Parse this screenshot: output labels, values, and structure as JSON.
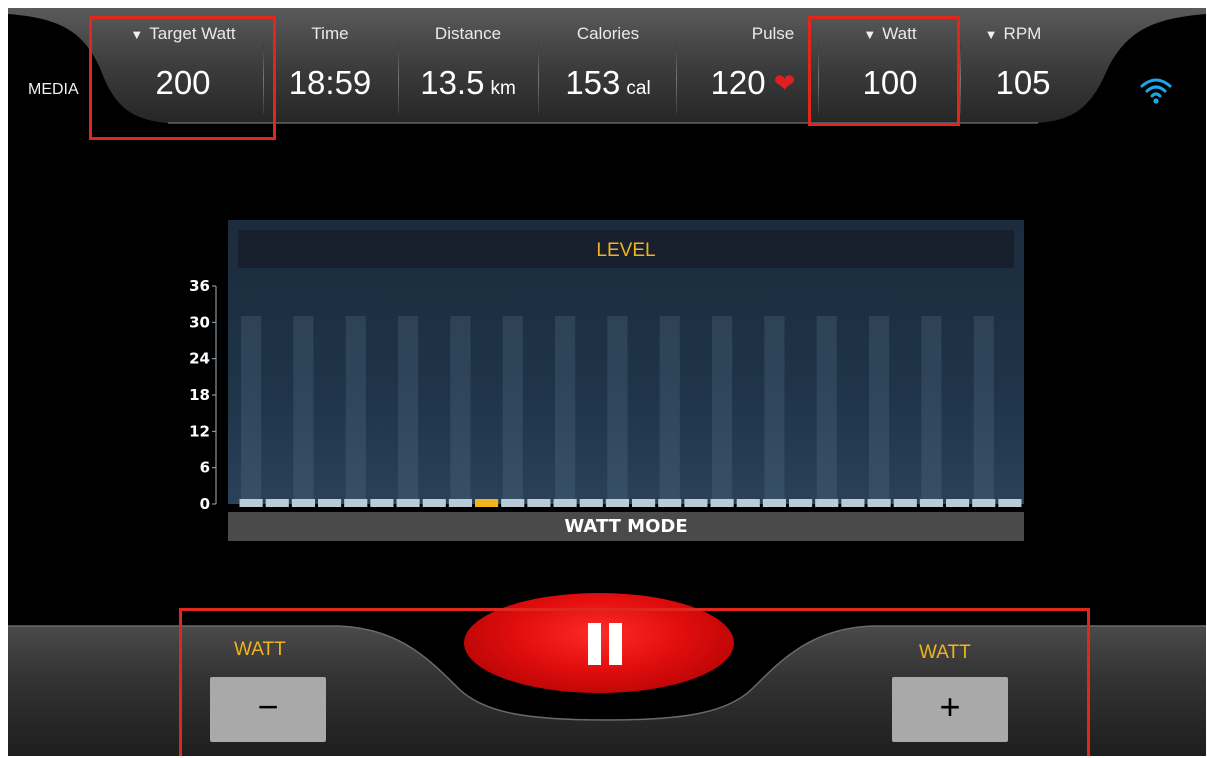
{
  "topbar": {
    "media_label": "MEDIA",
    "stats": {
      "target_watt": {
        "label": "Target Watt",
        "value": "200"
      },
      "time": {
        "label": "Time",
        "value": "18:59"
      },
      "distance": {
        "label": "Distance",
        "value": "13.5",
        "unit": "km"
      },
      "calories": {
        "label": "Calories",
        "value": "153",
        "unit": "cal"
      },
      "pulse": {
        "label": "Pulse",
        "value": "120"
      },
      "watt": {
        "label": "Watt",
        "value": "100"
      },
      "rpm": {
        "label": "RPM",
        "value": "105"
      }
    },
    "icons": [
      "triangle-down-icon",
      "heart-icon",
      "wifi-icon"
    ],
    "highlight_color": "#e0261d"
  },
  "chart_data": {
    "type": "bar",
    "title": "LEVEL",
    "footer": "WATT MODE",
    "yticks": [
      0,
      6,
      12,
      18,
      24,
      30,
      36
    ],
    "ylim": [
      0,
      36
    ],
    "segment_count": 30,
    "values": [
      1,
      1,
      1,
      1,
      1,
      1,
      1,
      1,
      1,
      1,
      1,
      1,
      1,
      1,
      1,
      1,
      1,
      1,
      1,
      1,
      1,
      1,
      1,
      1,
      1,
      1,
      1,
      1,
      1,
      1
    ],
    "current_index": 9,
    "colors": {
      "segment": "#b9cbd6",
      "current": "#f0b41c",
      "title": "#f0b41c"
    }
  },
  "controls": {
    "watt_minus": {
      "label": "WATT",
      "symbol": "−"
    },
    "watt_plus": {
      "label": "WATT",
      "symbol": "+"
    },
    "pause_color": "#e00d0d"
  }
}
